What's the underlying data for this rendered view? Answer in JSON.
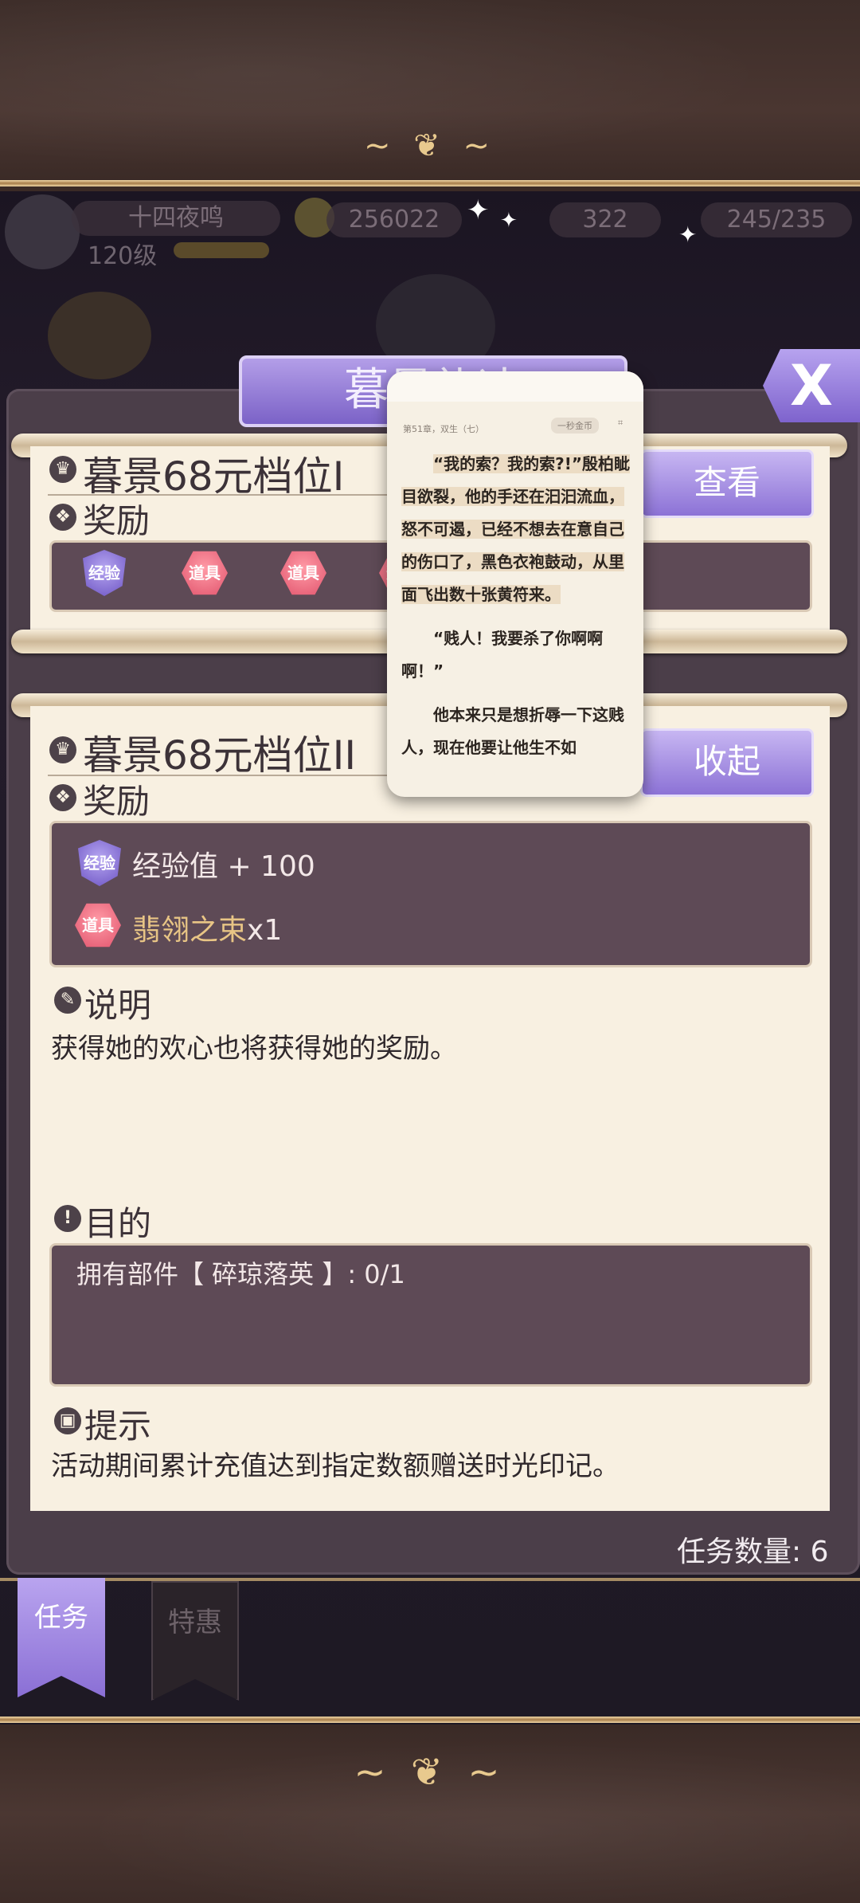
{
  "hud": {
    "player_name": "十四夜鸣",
    "player_level": "120级",
    "coins": "256022",
    "gems": "322",
    "stamina": "245/235"
  },
  "dialog": {
    "title": "暮景礼决",
    "close_label": "X"
  },
  "task1": {
    "title": "暮景68元档位I",
    "reward_label": "奖励",
    "view_button": "查看",
    "badges": [
      "经验",
      "道具",
      "道具",
      "道具"
    ]
  },
  "task2": {
    "title": "暮景68元档位II",
    "reward_label": "奖励",
    "collapse_button": "收起",
    "rewards": [
      {
        "badge": "经验",
        "text": "经验值 + 100"
      },
      {
        "badge": "道具",
        "name": "翡翎之束",
        "qty": "x1"
      }
    ],
    "description_label": "说明",
    "description": "获得她的欢心也将获得她的奖励。",
    "goal_label": "目的",
    "goal": "拥有部件【 碎琼落英 】: 0/1",
    "hint_label": "提示",
    "hint": "活动期间累计充值达到指定数额赠送时光印记。"
  },
  "task_count": "任务数量: 6",
  "tabs": {
    "active": "任务",
    "inactive": "特惠"
  },
  "reader": {
    "chapter": "第51章，双生（七）",
    "coin_button": "一秒金币",
    "paragraphs": [
      "“我的索？我的索?!”殷柏眦目欲裂，他的手还在汩汩流血，怒不可遏，已经不想去在意自己的伤口了，黑色衣袍鼓动，从里面飞出数十张黄符来。",
      "“贱人！我要杀了你啊啊啊！”",
      "他本来只是想折辱一下这贱人，现在他要让他生不如"
    ]
  },
  "colors": {
    "accent_purple": "#8c72d6",
    "panel_cream": "#f8f0e1",
    "dark_box": "#5e4a56",
    "item_name_gold": "#e8c585"
  }
}
